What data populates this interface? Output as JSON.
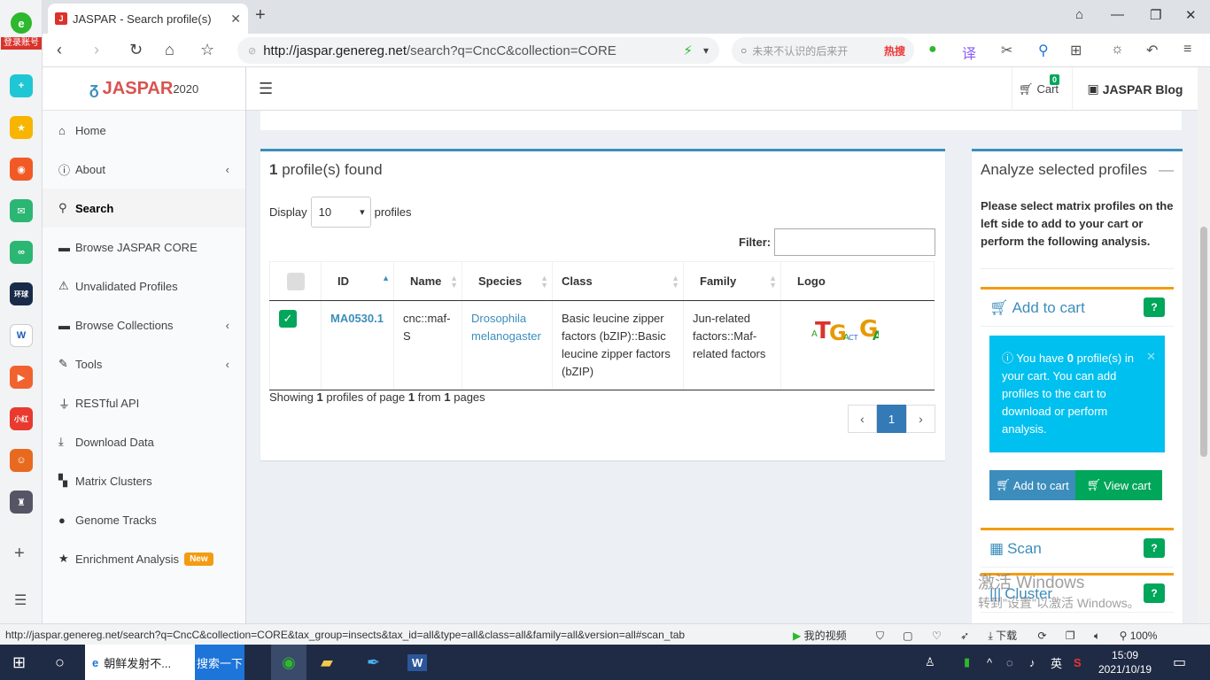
{
  "browser": {
    "left_badge": "登录账号",
    "tab_title": "JASPAR - Search profile(s)",
    "tab_favicon": "J",
    "url_host": "http://jaspar.genereg.net",
    "url_path": "/search?q=CncC&collection=CORE",
    "search_placeholder": "未来不认识的后来开",
    "search_hot": "热搜",
    "status_url": "http://jaspar.genereg.net/search?q=CncC&collection=CORE&tax_group=insects&tax_id=all&type=all&class=all&family=all&version=all#scan_tab",
    "status_video": "我的视频",
    "status_download": "下载",
    "status_zoom": "100%"
  },
  "app": {
    "logo_text": "JASPAR",
    "logo_version": "2020",
    "cart_label": "Cart",
    "cart_count": "0",
    "blog_label": "JASPAR Blog"
  },
  "sidebar": {
    "items": [
      {
        "label": "Home",
        "icon": "home-icon"
      },
      {
        "label": "About",
        "icon": "info-icon"
      },
      {
        "label": "Search",
        "icon": "search-icon"
      },
      {
        "label": "Browse JASPAR CORE",
        "icon": "folder-icon"
      },
      {
        "label": "Unvalidated Profiles",
        "icon": "warning-icon"
      },
      {
        "label": "Browse Collections",
        "icon": "folder-icon"
      },
      {
        "label": "Tools",
        "icon": "wrench-icon"
      },
      {
        "label": "RESTful API",
        "icon": "plug-icon"
      },
      {
        "label": "Download Data",
        "icon": "download-icon"
      },
      {
        "label": "Matrix Clusters",
        "icon": "clusters-icon"
      },
      {
        "label": "Genome Tracks",
        "icon": "map-marker-icon"
      },
      {
        "label": "Enrichment Analysis",
        "icon": "star-icon"
      }
    ],
    "new_badge": "New"
  },
  "results": {
    "count": "1",
    "title_suffix": "profile(s) found",
    "display_label": "Display",
    "display_value": "10",
    "display_suffix": "profiles",
    "filter_label": "Filter:",
    "columns": [
      "ID",
      "Name",
      "Species",
      "Class",
      "Family",
      "Logo"
    ],
    "row": {
      "id": "MA0530.1",
      "name": "cnc::maf-S",
      "species": "Drosophila melanogaster",
      "class": "Basic leucine zipper factors (bZIP)::Basic leucine zipper factors (bZIP)",
      "family": "Jun-related factors::Maf-related factors",
      "logo_letters": "ATGACTCAGCAAT"
    },
    "showing_prefix": "Showing",
    "showing_count": "1",
    "showing_mid": "profiles of page",
    "showing_page": "1",
    "showing_from": "from",
    "showing_pages": "1",
    "showing_suffix": "pages",
    "current_page": "1"
  },
  "analyze": {
    "title": "Analyze selected profiles",
    "description": "Please select matrix profiles on the left side to add to your cart or perform the following analysis.",
    "add_to_cart_title": "Add to cart",
    "info_prefix": "You have",
    "info_count": "0",
    "info_rest": "profile(s) in your cart. You can add profiles to the cart to download or perform analysis.",
    "add_btn": "Add to cart",
    "view_btn": "View cart",
    "scan_title": "Scan",
    "cluster_title": "Cluster"
  },
  "watermark": {
    "line1": "激活 Windows",
    "line2": "转到\"设置\"以激活 Windows。"
  },
  "taskbar": {
    "ie_label": "朝鲜发射不...",
    "search_btn": "搜索一下",
    "ime": "英",
    "time": "15:09",
    "date": "2021/10/19"
  }
}
